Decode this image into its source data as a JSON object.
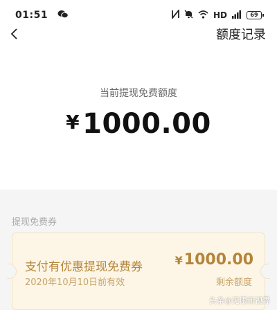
{
  "status_bar": {
    "time": "01:51",
    "network": "HD",
    "battery": "69",
    "icons": [
      "wechat-icon",
      "nfc-icon",
      "mute-icon",
      "wifi-icon",
      "signal-icon",
      "battery-icon"
    ]
  },
  "nav": {
    "back_icon": "chevron-left-icon",
    "records_label": "额度记录"
  },
  "hero": {
    "label": "当前提现免费额度",
    "currency": "¥",
    "amount": "1000.00"
  },
  "section": {
    "title": "提现免费券"
  },
  "coupon": {
    "title": "支付有优惠提现免费券",
    "expiry": "2020年10月10日前有效",
    "currency": "¥",
    "amount": "1000.00",
    "amount_label": "剩余额度"
  },
  "watermark": "头条@无限新视界",
  "colors": {
    "accent": "#b4843a",
    "coupon_bg": "#fdf6e6",
    "page_bg": "#f5f5f5"
  }
}
